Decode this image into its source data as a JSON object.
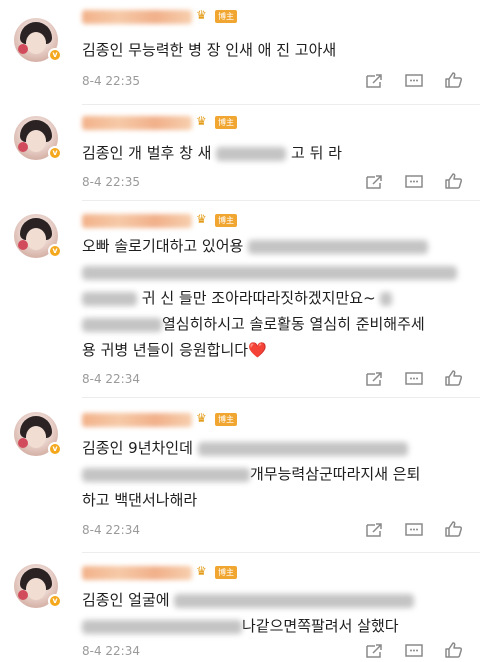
{
  "badge_label": "博主",
  "comments": [
    {
      "text_segments": [
        "김종인 무능력한 병  장  인새   애    진 고아새"
      ],
      "time": "8-4 22:35"
    },
    {
      "text_segments": [
        "김종인 개  벌후   창  새",
        "고 뒤  라"
      ],
      "time": "8-4 22:35"
    },
    {
      "text_segments": [
        "오빠 솔로기대하고 있어용",
        "",
        "귀   신     들만 조아라따라짓하겠지만요~",
        "열심히하시고 솔로활동 열심히 준비해주세",
        "용 귀병    년들이 응원합니다❤️"
      ],
      "time": "8-4 22:34"
    },
    {
      "text_segments": [
        "김종인 9년차인데",
        "개무능력삼군따라지새    은퇴",
        "하고 백댄서나해라"
      ],
      "time": "8-4 22:34"
    },
    {
      "text_segments": [
        "김종인 얼굴에",
        "나같으면쪽팔려서    살했다"
      ],
      "time": "8-4 22:34"
    }
  ],
  "icons": [
    "share-icon",
    "comment-icon",
    "like-icon"
  ]
}
